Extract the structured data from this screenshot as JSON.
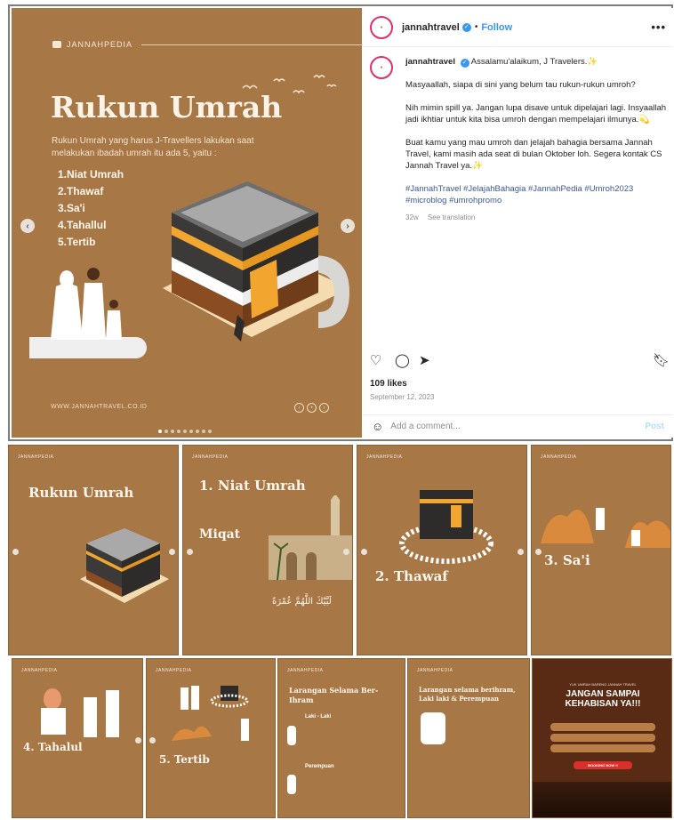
{
  "post": {
    "brand": "JANNAHPEDIA",
    "title": "Rukun Umrah",
    "subtitle": "Rukun Umrah yang harus J-Travellers lakukan saat melakukan ibadah umrah itu ada 5, yaitu :",
    "list": [
      "1.Niat Umrah",
      "2.Thawaf",
      "3.Sa'i",
      "4.Tahallul",
      "5.Tertib"
    ],
    "website": "WWW.JANNAHTRAVEL.CO.ID",
    "colors": {
      "brown": "#a77746",
      "cream": "#fbf3e8"
    }
  },
  "panel": {
    "username": "jannahtravel",
    "follow": "Follow",
    "more": "•••",
    "caption_greeting": "Assalamu'alaikum, J Travelers.✨",
    "caption_paragraphs": [
      "Masyaallah, siapa di sini yang belum tau rukun-rukun umroh?",
      "Nih mimin spill ya. Jangan lupa disave untuk dipelajari lagi. Insyaallah jadi ikhtiar untuk kita bisa umroh dengan mempelajari ilmunya.💫",
      "Buat kamu yang mau umroh dan jelajah bahagia bersama Jannah Travel, kami masih ada seat di bulan Oktober loh. Segera kontak CS Jannah Travel ya.✨"
    ],
    "hashtags": "#JannahTravel #JelajahBahagia #JannahPedia #Umroh2023 #microblog #umrohpromo",
    "age": "32w",
    "see_translation": "See translation",
    "likes": "109 likes",
    "date": "September 12, 2023",
    "comment_placeholder": "Add a comment...",
    "post_btn": "Post"
  },
  "slides": [
    {
      "title": "Rukun Umrah",
      "brand": "JANNAHPEDIA"
    },
    {
      "title": "1. Niat Umrah",
      "sub": "Miqat",
      "arabic": "لَبَّيْكَ اللَّهُمَّ عُمْرَةً",
      "brand": "JANNAHPEDIA"
    },
    {
      "title": "2. Thawaf",
      "brand": "JANNAHPEDIA"
    },
    {
      "title": "3. Sa'i",
      "brand": "JANNAHPEDIA"
    },
    {
      "title": "4. Tahalul",
      "brand": "JANNAHPEDIA"
    },
    {
      "title": "5. Tertib",
      "brand": "JANNAHPEDIA"
    },
    {
      "title": "Larangan Selama Ber-Ihram",
      "sub1": "Laki - Laki",
      "sub2": "Perempuan",
      "brand": "JANNAHPEDIA"
    },
    {
      "title": "Larangan selama berihram, Laki laki & Perempuan",
      "brand": "JANNAHPEDIA"
    },
    {
      "title": "JANGAN SAMPAI KEHABISAN YA!!!",
      "top": "YUK UMRAH BARENG JANNAH TRAVEL",
      "btn": "BOOKING NOW !!"
    }
  ]
}
